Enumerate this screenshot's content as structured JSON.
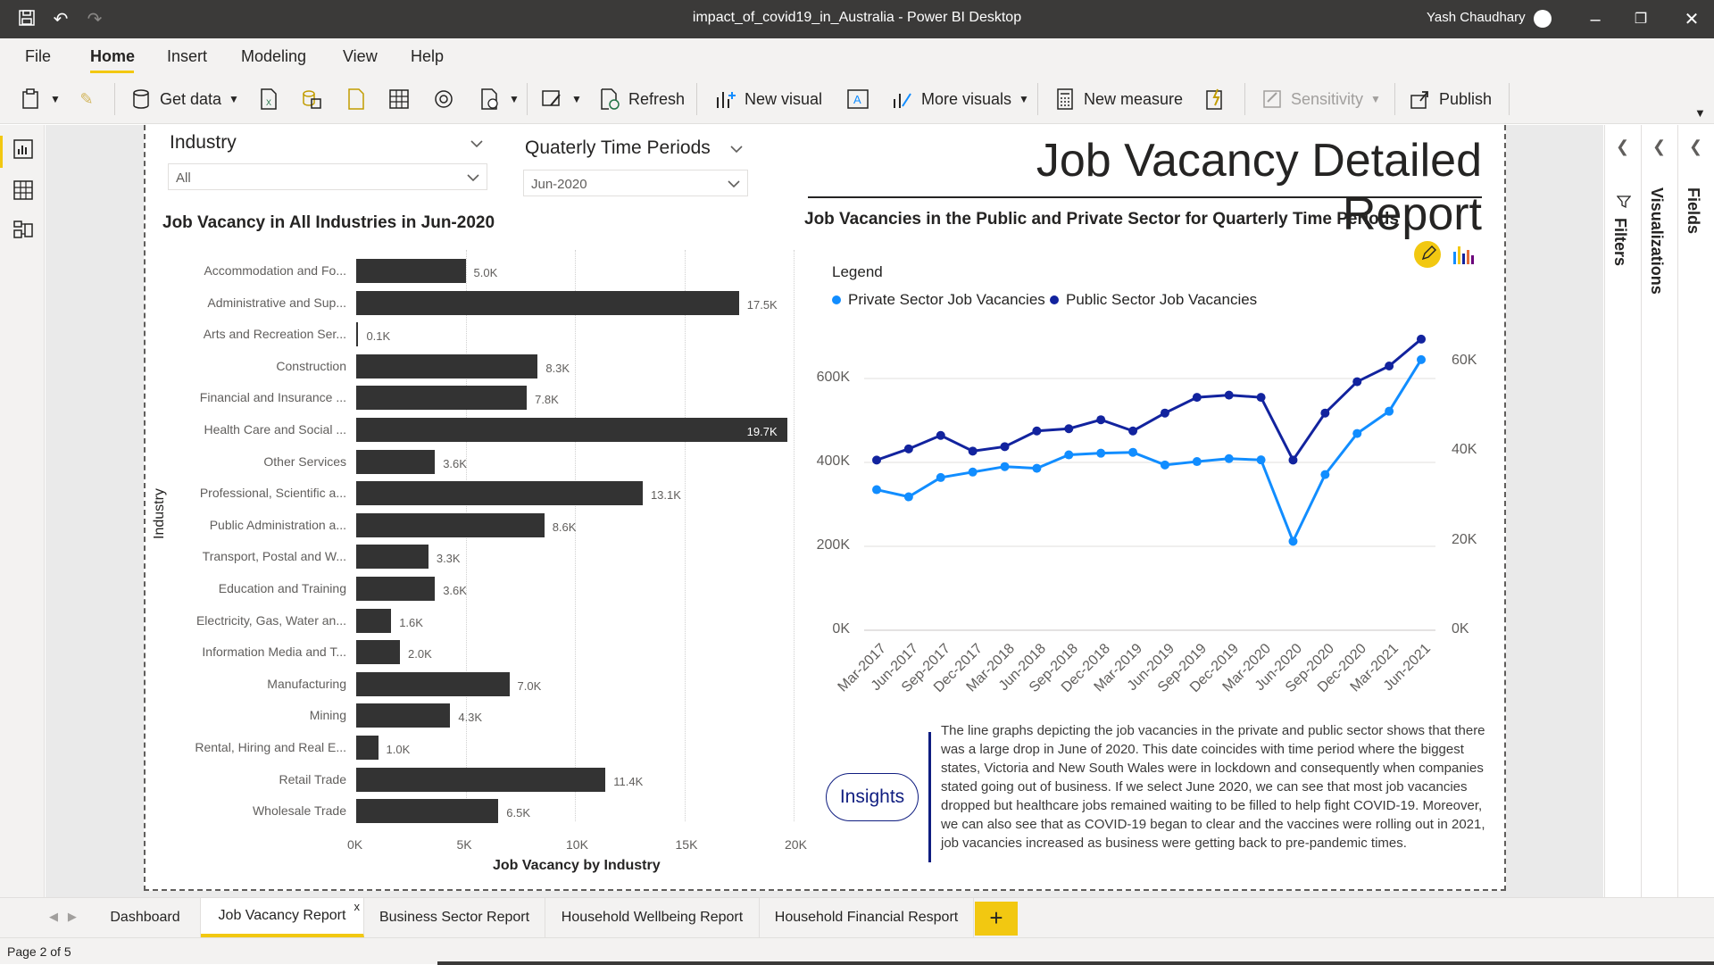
{
  "window": {
    "title": "impact_of_covid19_in_Australia - Power BI Desktop",
    "user": "Yash Chaudhary"
  },
  "menu": {
    "items": [
      "File",
      "Home",
      "Insert",
      "Modeling",
      "View",
      "Help"
    ],
    "active": "Home"
  },
  "ribbon": {
    "get_data": "Get data",
    "refresh": "Refresh",
    "new_visual": "New visual",
    "more_visuals": "More visuals",
    "new_measure": "New measure",
    "sensitivity": "Sensitivity",
    "publish": "Publish"
  },
  "panes": {
    "filters": "Filters",
    "visualizations": "Visualizations",
    "fields": "Fields"
  },
  "slicers": {
    "industry": {
      "title": "Industry",
      "value": "All"
    },
    "period": {
      "title": "Quaterly Time Periods",
      "value": "Jun-2020"
    }
  },
  "report": {
    "title": "Job Vacancy Detailed Report"
  },
  "bar_chart": {
    "title": "Job Vacancy in All Industries in Jun-2020",
    "y_axis_title": "Industry",
    "x_axis_title": "Job Vacancy by Industry",
    "x_ticks": [
      "0K",
      "5K",
      "10K",
      "15K",
      "20K"
    ]
  },
  "line_chart": {
    "title": "Job Vacancies in the Public and Private Sector for Quarterly Time Periods",
    "legend_title": "Legend",
    "left_ticks": [
      "0K",
      "200K",
      "400K",
      "600K"
    ],
    "right_ticks": [
      "0K",
      "20K",
      "40K",
      "60K"
    ]
  },
  "insights": {
    "button": "Insights",
    "text": "The line graphs depicting the job vacancies in the private and public sector shows that there was a large drop in June of 2020. This date coincides with time period where the biggest states, Victoria and New South Wales were in lockdown and consequently when companies stated going out of business. If we select June 2020, we can see that most job vacancies dropped but healthcare jobs remained waiting to be filled to help fight COVID-19. Moreover, we can also see that as COVID-19 began to clear and the vaccines were rolling out in 2021, job vacancies increased as business were getting back to pre-pandemic times."
  },
  "tabs": [
    "Dashboard",
    "Job Vacancy Report",
    "Business Sector Report",
    "Household Wellbeing Report",
    "Household Financial Resport"
  ],
  "tab_close": "x",
  "tab_add": "+",
  "status": {
    "page": "Page 2 of 5"
  },
  "colors": {
    "accent": "#f2c811",
    "bar": "#333333",
    "private": "#118dff",
    "public": "#12239e"
  },
  "chart_data": [
    {
      "type": "bar",
      "title": "Job Vacancy in All Industries in Jun-2020",
      "xlabel": "Job Vacancy by Industry",
      "ylabel": "Industry",
      "xlim": [
        0,
        20
      ],
      "categories": [
        "Accommodation and Fo...",
        "Administrative and Sup...",
        "Arts and Recreation Ser...",
        "Construction",
        "Financial and Insurance ...",
        "Health Care and Social ...",
        "Other Services",
        "Professional, Scientific a...",
        "Public Administration a...",
        "Transport, Postal and W...",
        "Education and Training",
        "Electricity, Gas, Water an...",
        "Information Media and T...",
        "Manufacturing",
        "Mining",
        "Rental, Hiring and Real E...",
        "Retail Trade",
        "Wholesale Trade"
      ],
      "values": [
        5.0,
        17.5,
        0.1,
        8.3,
        7.8,
        19.7,
        3.6,
        13.1,
        8.6,
        3.3,
        3.6,
        1.6,
        2.0,
        7.0,
        4.3,
        1.0,
        11.4,
        6.5
      ],
      "value_labels": [
        "5.0K",
        "17.5K",
        "0.1K",
        "8.3K",
        "7.8K",
        "19.7K",
        "3.6K",
        "13.1K",
        "8.6K",
        "3.3K",
        "3.6K",
        "1.6K",
        "2.0K",
        "7.0K",
        "4.3K",
        "1.0K",
        "11.4K",
        "6.5K"
      ],
      "unit": "K"
    },
    {
      "type": "line",
      "title": "Job Vacancies in the Public and Private Sector for Quarterly Time Periods",
      "legend_position": "top-left",
      "x_labels": [
        "Mar-2017",
        "Jun-2017",
        "Sep-2017",
        "Dec-2017",
        "Mar-2018",
        "Jun-2018",
        "Sep-2018",
        "Dec-2018",
        "Mar-2019",
        "Jun-2019",
        "Sep-2019",
        "Dec-2019",
        "Mar-2020",
        "Jun-2020",
        "Sep-2020",
        "Dec-2020",
        "Mar-2021",
        "Jun-2021"
      ],
      "x": [
        "Mar-2017",
        "Jun-2017",
        "Sep-2017",
        "Dec-2017",
        "Mar-2018",
        "Jun-2018",
        "Sep-2018",
        "Dec-2018",
        "Mar-2019",
        "Jun-2019",
        "Sep-2019",
        "Dec-2019",
        "Mar-2020",
        "Jun-2020",
        "Sep-2020",
        "Dec-2020",
        "Mar-2021",
        "Jun-2021"
      ],
      "series": [
        {
          "name": "Private Sector Job Vacancies",
          "axis": "left",
          "ylim": [
            0,
            600000
          ],
          "values": [
            335000,
            318000,
            364000,
            377000,
            390000,
            386000,
            418000,
            422000,
            424000,
            394000,
            402000,
            409000,
            406000,
            212000,
            371000,
            469000,
            522000,
            645000
          ]
        },
        {
          "name": "Public Sector Job Vacancies",
          "axis": "right",
          "ylim": [
            0,
            60000
          ],
          "values": [
            38000,
            40500,
            43500,
            40000,
            41000,
            44500,
            45000,
            47000,
            44500,
            48500,
            52000,
            52500,
            52000,
            38000,
            48500,
            55500,
            59000,
            65000
          ]
        }
      ]
    }
  ]
}
